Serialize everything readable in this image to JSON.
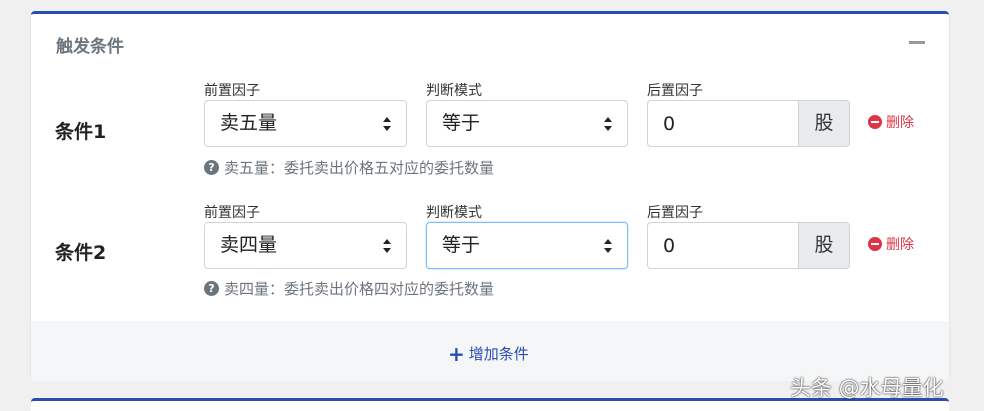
{
  "card": {
    "title": "触发条件"
  },
  "labels": {
    "front_factor": "前置因子",
    "judge_mode": "判断模式",
    "rear_factor": "后置因子",
    "delete": "删除",
    "unit": "股"
  },
  "conditions": [
    {
      "label": "条件1",
      "front_factor_value": "卖五量",
      "judge_mode_value": "等于",
      "rear_value": "0",
      "help": "卖五量：委托卖出价格五对应的委托数量"
    },
    {
      "label": "条件2",
      "front_factor_value": "卖四量",
      "judge_mode_value": "等于",
      "rear_value": "0",
      "help": "卖四量：委托卖出价格四对应的委托数量"
    }
  ],
  "footer": {
    "add_label": "增加条件"
  },
  "watermark": "头条 @水母量化",
  "colors": {
    "accent": "#2a4db1",
    "danger": "#dc3545",
    "muted": "#6c757d"
  }
}
